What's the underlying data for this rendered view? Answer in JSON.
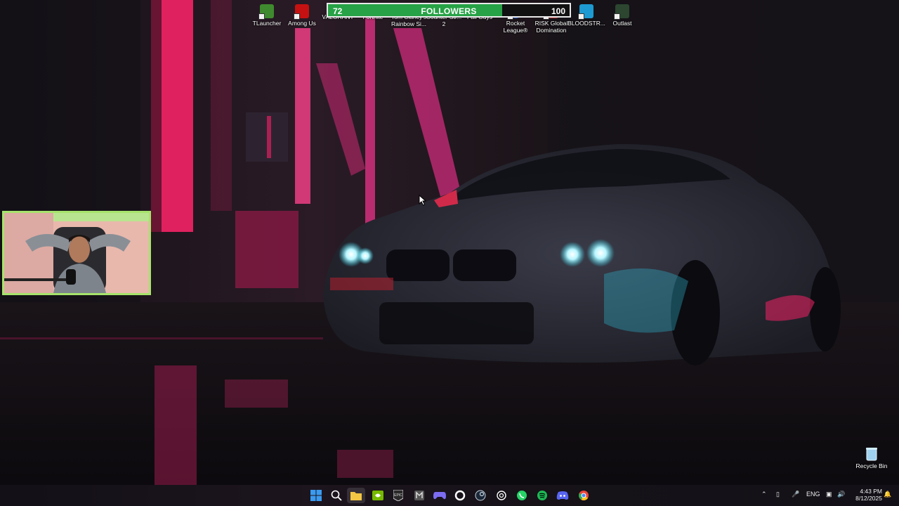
{
  "desktop_icons": [
    {
      "label": "TLauncher",
      "icon": "tlauncher-icon",
      "color": "#3f8a2e"
    },
    {
      "label": "Among Us",
      "icon": "among-us-icon",
      "color": "#c51111"
    },
    {
      "label": "VALORANT",
      "icon": "valorant-icon",
      "color": "#fd4556"
    },
    {
      "label": "Fortnite",
      "icon": "fortnite-icon",
      "color": "#2f6bd6"
    },
    {
      "label": "Tom Clancy's Rainbow Si...",
      "icon": "rainbow-six-icon",
      "color": "#cfcfcf"
    },
    {
      "label": "Counter-Str... 2",
      "icon": "counter-strike-icon",
      "color": "#de9b35"
    },
    {
      "label": "Fall Guys",
      "icon": "fall-guys-icon",
      "color": "#f07cc1"
    },
    {
      "label": "Rocket League®",
      "icon": "rocket-league-icon",
      "color": "#1f5bd0"
    },
    {
      "label": "RISK Global Domination",
      "icon": "risk-icon",
      "color": "#b32a2a"
    },
    {
      "label": "BLOODSTR...",
      "icon": "bloodstrike-icon",
      "color": "#1d9ad1"
    },
    {
      "label": "Outlast",
      "icon": "outlast-icon",
      "color": "#2c4630"
    }
  ],
  "followers": {
    "current": "72",
    "label": "FOLLOWERS",
    "goal": "100",
    "progress": 0.72,
    "fill_color": "#27a246"
  },
  "recycle_bin": {
    "label": "Recycle Bin",
    "icon": "recycle-bin-icon"
  },
  "taskbar": {
    "apps": [
      {
        "name": "start-button",
        "icon": "windows-logo-icon",
        "color": "#3a9bf0"
      },
      {
        "name": "search-button",
        "icon": "search-icon",
        "color": "#ffffff"
      },
      {
        "name": "file-explorer-button",
        "icon": "folder-icon",
        "color": "#f2c744"
      },
      {
        "name": "nvidia-button",
        "icon": "nvidia-icon",
        "color": "#76b900"
      },
      {
        "name": "epic-games-button",
        "icon": "epic-games-icon",
        "color": "#dddddd"
      },
      {
        "name": "media-button",
        "icon": "media-icon",
        "color": "#cccccc"
      },
      {
        "name": "game-bar-button",
        "icon": "gamepad-icon",
        "color": "#7c6cf0"
      },
      {
        "name": "app-o-button",
        "icon": "circle-app-icon",
        "color": "#ffffff"
      },
      {
        "name": "steam-button",
        "icon": "steam-icon",
        "color": "#c7d5e0"
      },
      {
        "name": "chatgpt-button",
        "icon": "chatgpt-icon",
        "color": "#ffffff"
      },
      {
        "name": "whatsapp-button",
        "icon": "whatsapp-icon",
        "color": "#25d366"
      },
      {
        "name": "spotify-button",
        "icon": "spotify-icon",
        "color": "#1db954"
      },
      {
        "name": "discord-button",
        "icon": "discord-icon",
        "color": "#5865f2"
      },
      {
        "name": "chrome-button",
        "icon": "chrome-icon",
        "color": "#e9463b"
      }
    ],
    "tray": {
      "language": "ENG",
      "time": "4:43 PM",
      "date": "8/12/2025"
    }
  }
}
